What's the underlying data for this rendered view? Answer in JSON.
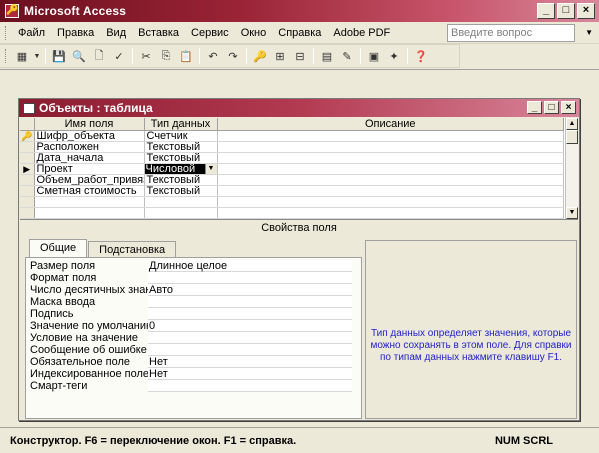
{
  "app": {
    "title": "Microsoft Access"
  },
  "window_buttons": {
    "minimize": "_",
    "maximize": "□",
    "close": "×"
  },
  "menubar": {
    "items": [
      "Файл",
      "Правка",
      "Вид",
      "Вставка",
      "Сервис",
      "Окно",
      "Справка",
      "Adobe PDF"
    ],
    "ask_placeholder": "Введите вопрос"
  },
  "toolbar": {
    "icons": [
      "view-icon",
      "save-icon",
      "search-icon",
      "print-preview-icon",
      "spelling-icon",
      "cut-icon",
      "copy-icon",
      "paste-icon",
      "undo-icon",
      "redo-icon",
      "primary-key-icon",
      "insert-rows-icon",
      "delete-rows-icon",
      "properties-icon",
      "build-icon",
      "database-window-icon",
      "new-object-icon",
      "help-icon"
    ]
  },
  "doc": {
    "title": "Объекты : таблица",
    "columns": [
      "Имя поля",
      "Тип данных",
      "Описание"
    ],
    "rows": [
      {
        "marker": "key",
        "name": "Шифр_объекта",
        "type": "Счетчик"
      },
      {
        "marker": "",
        "name": "Расположен",
        "type": "Текстовый"
      },
      {
        "marker": "",
        "name": "Дата_начала",
        "type": "Текстовый"
      },
      {
        "marker": "current",
        "name": "Проект",
        "type": "Числовой"
      },
      {
        "marker": "",
        "name": "Объем_работ_привязки_пр",
        "type": "Текстовый"
      },
      {
        "marker": "",
        "name": "Сметная стоимость",
        "type": "Текстовый"
      }
    ],
    "props_header": "Свойства поля",
    "tabs": [
      "Общие",
      "Подстановка"
    ],
    "properties": [
      {
        "name": "Размер поля",
        "value": "Длинное целое"
      },
      {
        "name": "Формат поля",
        "value": ""
      },
      {
        "name": "Число десятичных знаков",
        "value": "Авто"
      },
      {
        "name": "Маска ввода",
        "value": ""
      },
      {
        "name": "Подпись",
        "value": ""
      },
      {
        "name": "Значение по умолчанию",
        "value": "0"
      },
      {
        "name": "Условие на значение",
        "value": ""
      },
      {
        "name": "Сообщение об ошибке",
        "value": ""
      },
      {
        "name": "Обязательное поле",
        "value": "Нет"
      },
      {
        "name": "Индексированное поле",
        "value": "Нет"
      },
      {
        "name": "Смарт-теги",
        "value": ""
      }
    ],
    "help_text": "Тип данных определяет значения, которые можно сохранять в этом поле.  Для справки по типам данных нажмите клавишу F1."
  },
  "status": {
    "text": "Конструктор.  F6 = переключение окон.  F1 = справка.",
    "keys": "NUM  SCRL"
  }
}
